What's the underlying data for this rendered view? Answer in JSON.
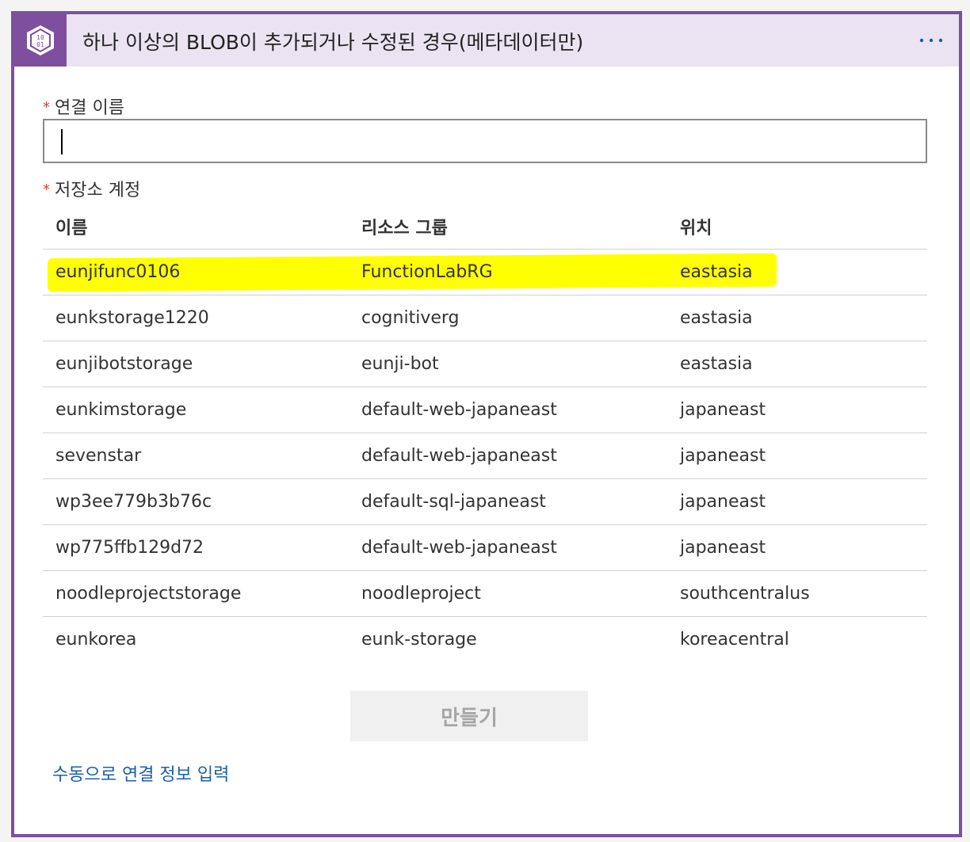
{
  "header": {
    "title": "하나 이상의 BLOB이 추가되거나 수정된 경우(메타데이터만)",
    "icon": "blob-storage-icon",
    "icon_text_top": "10",
    "icon_text_bottom": "01",
    "more": "more-options-icon",
    "accent_color": "#7d4f9e",
    "header_bg": "#ebe3f1"
  },
  "form": {
    "required_marker": "*",
    "connection_name_label": "연결 이름",
    "connection_name_value": "",
    "storage_account_label": "저장소 계정"
  },
  "table": {
    "columns": [
      "이름",
      "리소스 그룹",
      "위치"
    ],
    "rows": [
      {
        "name": "eunjifunc0106",
        "group": "FunctionLabRG",
        "location": "eastasia",
        "highlighted": true
      },
      {
        "name": "eunkstorage1220",
        "group": "cognitiverg",
        "location": "eastasia"
      },
      {
        "name": "eunjibotstorage",
        "group": "eunji-bot",
        "location": "eastasia"
      },
      {
        "name": "eunkimstorage",
        "group": "default-web-japaneast",
        "location": "japaneast"
      },
      {
        "name": "sevenstar",
        "group": "default-web-japaneast",
        "location": "japaneast"
      },
      {
        "name": "wp3ee779b3b76c",
        "group": "default-sql-japaneast",
        "location": "japaneast"
      },
      {
        "name": "wp775ffb129d72",
        "group": "default-web-japaneast",
        "location": "japaneast"
      },
      {
        "name": "noodleprojectstorage",
        "group": "noodleproject",
        "location": "southcentralus"
      },
      {
        "name": "eunkorea",
        "group": "eunk-storage",
        "location": "koreacentral"
      }
    ],
    "highlight_color": "#ffff00"
  },
  "actions": {
    "create_label": "만들기",
    "manual_link": "수동으로 연결 정보 입력",
    "link_color": "#1b5fa8"
  }
}
